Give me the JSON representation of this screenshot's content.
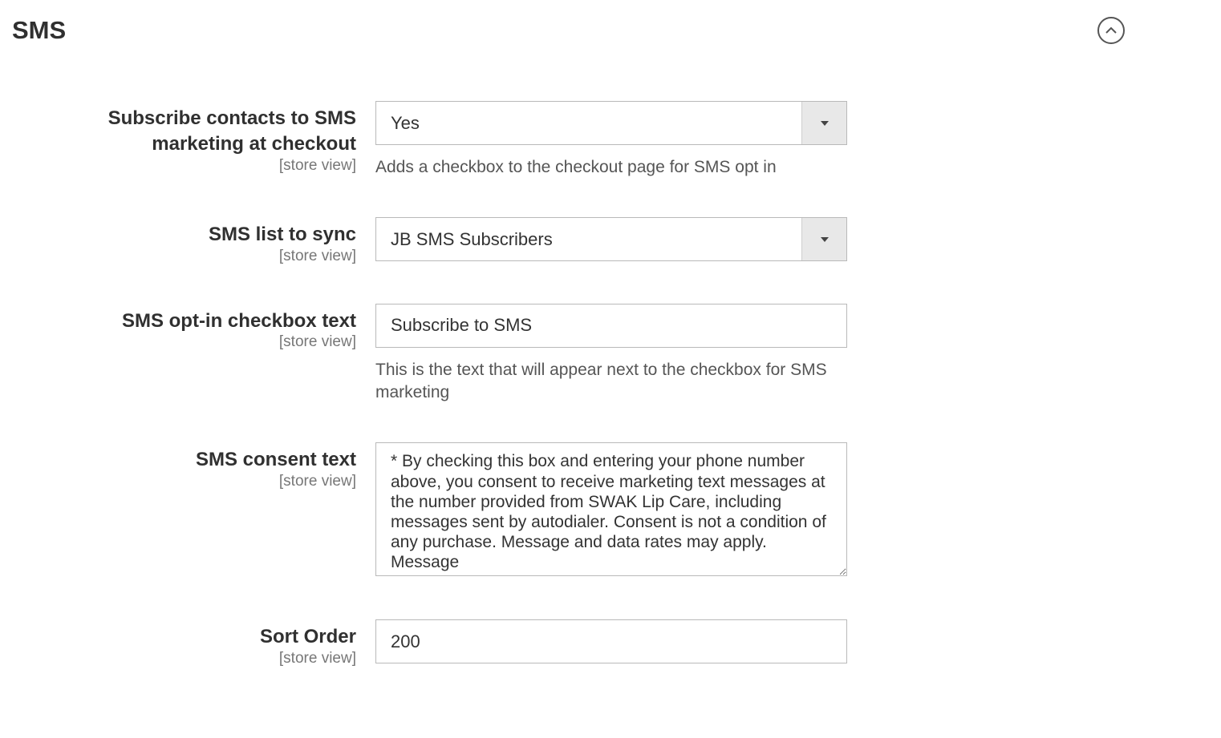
{
  "section": {
    "title": "SMS"
  },
  "fields": {
    "subscribe": {
      "label": "Subscribe contacts to SMS marketing at checkout",
      "scope": "[store view]",
      "value": "Yes",
      "help": "Adds a checkbox to the checkout page for SMS opt in"
    },
    "list": {
      "label": "SMS list to sync",
      "scope": "[store view]",
      "value": "JB SMS Subscribers"
    },
    "checkbox_text": {
      "label": "SMS opt-in checkbox text",
      "scope": "[store view]",
      "value": "Subscribe to SMS",
      "help": "This is the text that will appear next to the checkbox for SMS marketing"
    },
    "consent": {
      "label": "SMS consent text",
      "scope": "[store view]",
      "value": "* By checking this box and entering your phone number above, you consent to receive marketing text messages at the number provided from SWAK Lip Care, including messages sent by autodialer. Consent is not a condition of any purchase. Message and data rates may apply. Message"
    },
    "sort_order": {
      "label": "Sort Order",
      "scope": "[store view]",
      "value": "200"
    }
  }
}
